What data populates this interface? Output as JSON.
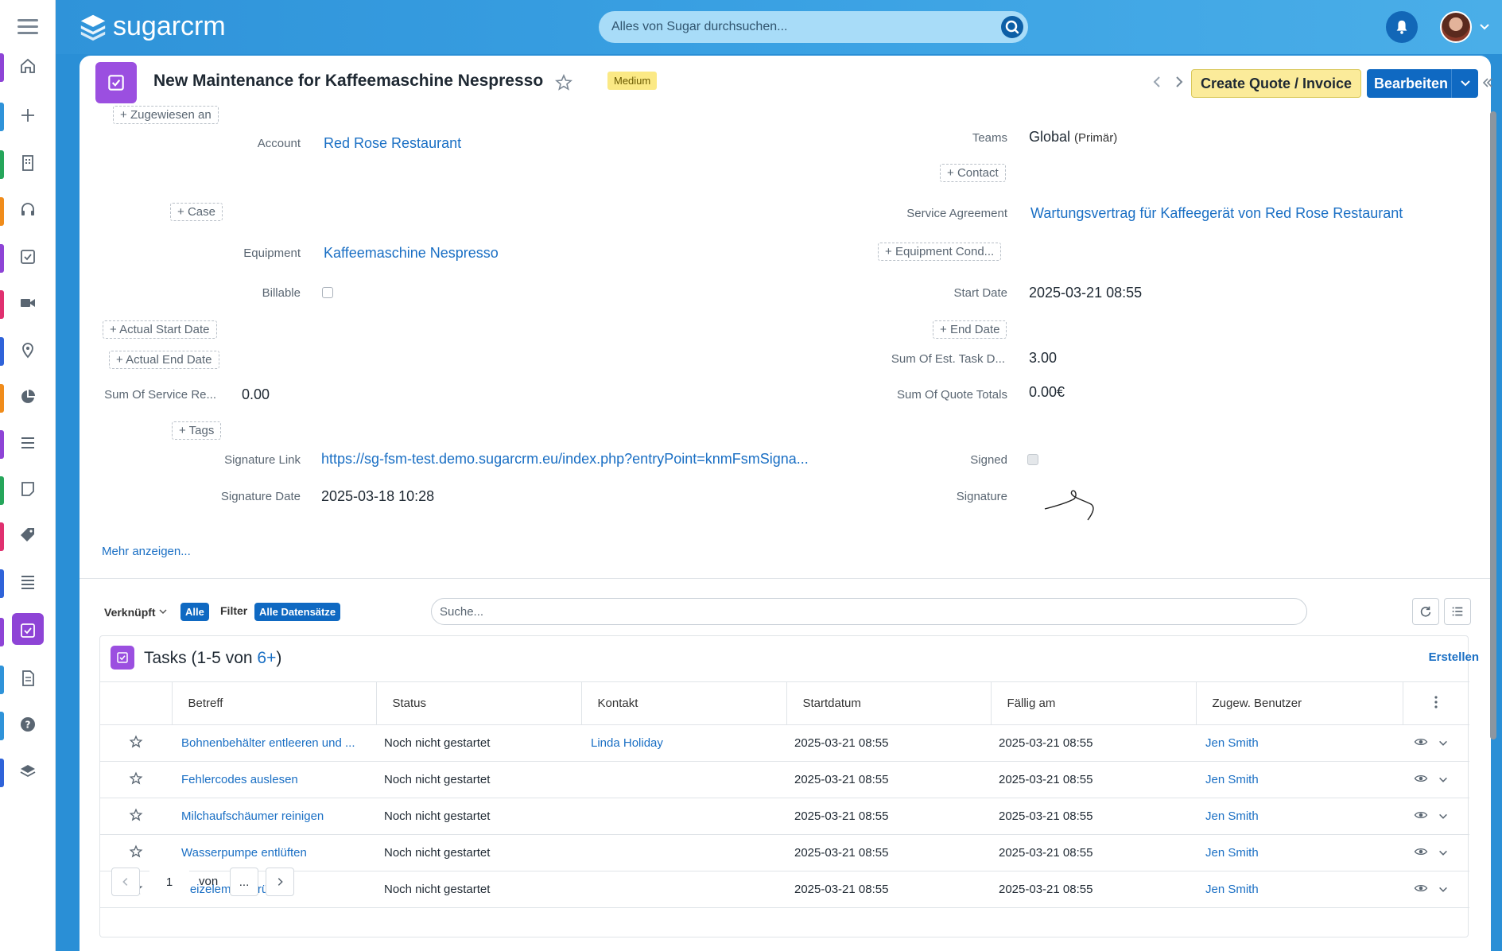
{
  "app": {
    "brand": "sugarcrm",
    "search_placeholder": "Alles von Sugar durchsuchen..."
  },
  "colors": {
    "accent": "#0f69c2",
    "module_tasks": "#9b4fe0",
    "badge_medium": "#fbe985"
  },
  "nav": [
    {
      "name": "home-icon",
      "color": "#8e44d6"
    },
    {
      "name": "plus-icon",
      "color": "#2f93d9"
    },
    {
      "name": "building-icon",
      "color": "#26a65b"
    },
    {
      "name": "headset-icon",
      "color": "#f08c1b"
    },
    {
      "name": "task-icon",
      "color": "#8e44d6"
    },
    {
      "name": "video-icon",
      "color": "#e0306f"
    },
    {
      "name": "map-pin-icon",
      "color": "#2f63d9"
    },
    {
      "name": "pie-chart-icon",
      "color": "#f08c1b"
    },
    {
      "name": "list-icon",
      "color": "#8e44d6"
    },
    {
      "name": "note-icon",
      "color": "#26a65b"
    },
    {
      "name": "tag-icon",
      "color": "#e0306f"
    },
    {
      "name": "grid-list-icon",
      "color": "#2f63d9"
    },
    {
      "name": "task-active-icon",
      "color": "#8e44d6"
    },
    {
      "name": "document-icon",
      "color": "#2f93d9"
    },
    {
      "name": "help-icon",
      "color": "#2f93d9"
    },
    {
      "name": "layers-icon",
      "color": "#2f63d9"
    }
  ],
  "record": {
    "title": "New Maintenance for Kaffeemaschine Nespresso",
    "priority": "Medium",
    "create_quote_label": "Create Quote / Invoice",
    "edit_label": "Bearbeiten"
  },
  "fields": {
    "assigned_add": "Zugewiesen an",
    "teams_label": "Teams",
    "teams_value": "Global",
    "teams_primary": "(Primär)",
    "account_label": "Account",
    "account_value": "Red Rose Restaurant",
    "contact_add": "Contact",
    "case_add": "Case",
    "service_agreement_label": "Service Agreement",
    "service_agreement_value": "Wartungsvertrag für Kaffeegerät von Red Rose Restaurant",
    "equipment_label": "Equipment",
    "equipment_value": "Kaffeemaschine Nespresso",
    "equipment_cond_add": "Equipment Cond...",
    "billable_label": "Billable",
    "start_date_label": "Start Date",
    "start_date_value": "2025-03-21 08:55",
    "actual_start_add": "Actual Start Date",
    "end_date_add": "End Date",
    "actual_end_add": "Actual End Date",
    "sum_est_label": "Sum Of Est. Task D...",
    "sum_est_value": "3.00",
    "sum_service_label": "Sum Of Service Re...",
    "sum_service_value": "0.00",
    "sum_quote_label": "Sum Of Quote Totals",
    "sum_quote_value": "0.00€",
    "tags_add": "Tags",
    "signature_link_label": "Signature Link",
    "signature_link_value": "https://sg-fsm-test.demo.sugarcrm.eu/index.php?entryPoint=knmFsmSigna...",
    "signed_label": "Signed",
    "signature_date_label": "Signature Date",
    "signature_date_value": "2025-03-18 10:28",
    "signature_label": "Signature",
    "more_label": "Mehr anzeigen..."
  },
  "subpanel_bar": {
    "related_label": "Verknüpft",
    "all_pill": "Alle",
    "filter_label": "Filter",
    "all_records_pill": "Alle Datensätze",
    "search_placeholder": "Suche..."
  },
  "tasks": {
    "title_prefix": "Tasks (1-5 von ",
    "count": "6+",
    "title_suffix": ")",
    "create_label": "Erstellen",
    "columns": [
      "Betreff",
      "Status",
      "Kontakt",
      "Startdatum",
      "Fällig am",
      "Zugew. Benutzer"
    ],
    "rows": [
      {
        "subject": "Bohnenbehälter entleeren und ...",
        "status": "Noch nicht gestartet",
        "contact": "Linda Holiday",
        "start": "2025-03-21 08:55",
        "due": "2025-03-21 08:55",
        "user": "Jen Smith"
      },
      {
        "subject": "Fehlercodes auslesen",
        "status": "Noch nicht gestartet",
        "contact": "",
        "start": "2025-03-21 08:55",
        "due": "2025-03-21 08:55",
        "user": "Jen Smith"
      },
      {
        "subject": "Milchaufschäumer reinigen",
        "status": "Noch nicht gestartet",
        "contact": "",
        "start": "2025-03-21 08:55",
        "due": "2025-03-21 08:55",
        "user": "Jen Smith"
      },
      {
        "subject": "Wasserpumpe entlüften",
        "status": "Noch nicht gestartet",
        "contact": "",
        "start": "2025-03-21 08:55",
        "due": "2025-03-21 08:55",
        "user": "Jen Smith"
      },
      {
        "subject": "Heizelement prüfen",
        "status": "Noch nicht gestartet",
        "contact": "",
        "start": "2025-03-21 08:55",
        "due": "2025-03-21 08:55",
        "user": "Jen Smith"
      }
    ],
    "pager": {
      "page": "1",
      "of_label": "von",
      "total": "..."
    }
  }
}
